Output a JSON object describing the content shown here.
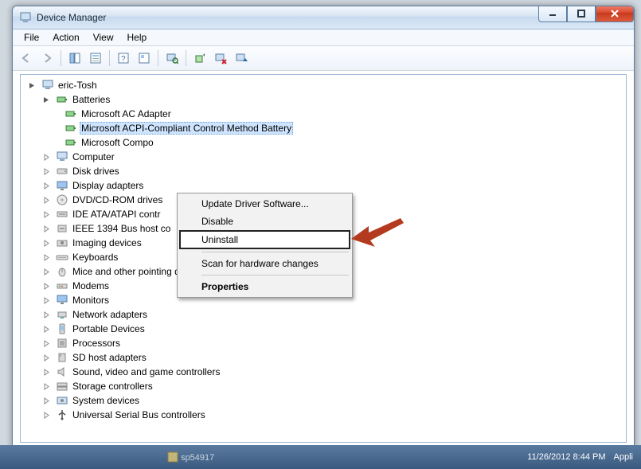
{
  "window": {
    "title": "Device Manager"
  },
  "menu": {
    "file": "File",
    "action": "Action",
    "view": "View",
    "help": "Help"
  },
  "tree": {
    "root": "eric-Tosh",
    "batteries": {
      "label": "Batteries",
      "items": [
        "Microsoft AC Adapter",
        "Microsoft ACPI-Compliant Control Method Battery",
        "Microsoft Compo"
      ]
    },
    "categories": [
      "Computer",
      "Disk drives",
      "Display adapters",
      "DVD/CD-ROM drives",
      "IDE ATA/ATAPI contr",
      "IEEE 1394 Bus host co",
      "Imaging devices",
      "Keyboards",
      "Mice and other pointing devices",
      "Modems",
      "Monitors",
      "Network adapters",
      "Portable Devices",
      "Processors",
      "SD host adapters",
      "Sound, video and game controllers",
      "Storage controllers",
      "System devices",
      "Universal Serial Bus controllers"
    ]
  },
  "context": {
    "update": "Update Driver Software...",
    "disable": "Disable",
    "uninstall": "Uninstall",
    "scan": "Scan for hardware changes",
    "properties": "Properties"
  },
  "taskbar": {
    "item": "sp54917",
    "datetime": "11/26/2012 8:44 PM",
    "app": "Appli"
  }
}
